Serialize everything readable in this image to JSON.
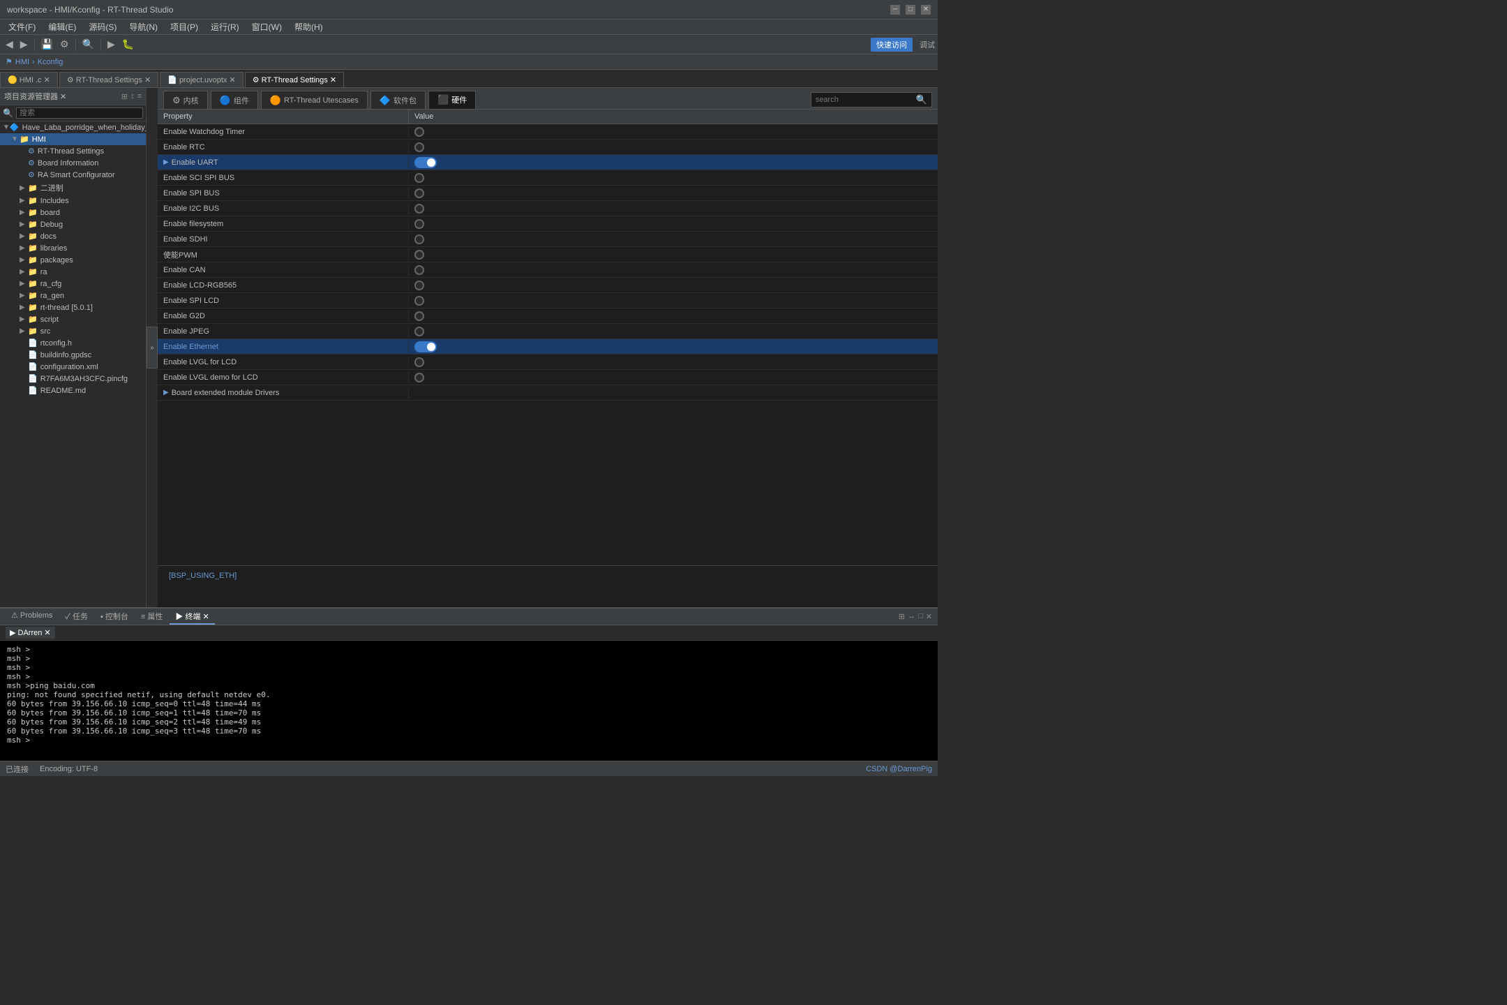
{
  "titleBar": {
    "text": "workspace - HMI/Kconfig - RT-Thread Studio",
    "controls": [
      "minimize",
      "maximize",
      "close"
    ]
  },
  "menuBar": {
    "items": [
      "文件(F)",
      "编辑(E)",
      "源码(S)",
      "导航(N)",
      "项目(P)",
      "运行(R)",
      "窗口(W)",
      "帮助(H)"
    ]
  },
  "breadcrumb": {
    "path": "HMI > Kconfig"
  },
  "mainTabs": [
    {
      "label": "HMI .c",
      "active": false
    },
    {
      "label": "RT-Thread Settings",
      "active": false
    },
    {
      "label": "project.uvoptx",
      "active": false
    },
    {
      "label": "RT-Thread Settings",
      "active": true
    }
  ],
  "sidebar": {
    "header": "项目资源管理器",
    "searchPlaceholder": "搜索",
    "tree": [
      {
        "id": "root",
        "label": "Have_Laba_porridge_when_holiday_come",
        "level": 0,
        "type": "project",
        "expanded": true
      },
      {
        "id": "hmi",
        "label": "HMI",
        "level": 1,
        "type": "folder",
        "expanded": true
      },
      {
        "id": "rt-thread-settings",
        "label": "RT-Thread Settings",
        "level": 2,
        "type": "settings"
      },
      {
        "id": "board-info",
        "label": "Board Information",
        "level": 2,
        "type": "settings"
      },
      {
        "id": "ra-smart",
        "label": "RA Smart Configurator",
        "level": 2,
        "type": "settings"
      },
      {
        "id": "binary",
        "label": "二进制",
        "level": 2,
        "type": "folder"
      },
      {
        "id": "includes",
        "label": "Includes",
        "level": 2,
        "type": "folder"
      },
      {
        "id": "board",
        "label": "board",
        "level": 2,
        "type": "folder"
      },
      {
        "id": "debug",
        "label": "Debug",
        "level": 2,
        "type": "folder"
      },
      {
        "id": "docs",
        "label": "docs",
        "level": 2,
        "type": "folder"
      },
      {
        "id": "libraries",
        "label": "libraries",
        "level": 2,
        "type": "folder"
      },
      {
        "id": "packages",
        "label": "packages",
        "level": 2,
        "type": "folder"
      },
      {
        "id": "ra",
        "label": "ra",
        "level": 2,
        "type": "folder"
      },
      {
        "id": "ra_cfg",
        "label": "ra_cfg",
        "level": 2,
        "type": "folder"
      },
      {
        "id": "ra_gen",
        "label": "ra_gen",
        "level": 2,
        "type": "folder"
      },
      {
        "id": "rt-thread",
        "label": "rt-thread [5.0.1]",
        "level": 2,
        "type": "folder"
      },
      {
        "id": "script",
        "label": "script",
        "level": 2,
        "type": "folder"
      },
      {
        "id": "src",
        "label": "src",
        "level": 2,
        "type": "folder"
      },
      {
        "id": "rtconfig-h",
        "label": "rtconfig.h",
        "level": 2,
        "type": "file"
      },
      {
        "id": "buildinfo",
        "label": "buildinfo.gpdsc",
        "level": 2,
        "type": "file"
      },
      {
        "id": "config-xml",
        "label": "configuration.xml",
        "level": 2,
        "type": "file"
      },
      {
        "id": "pincfg",
        "label": "R7FA6M3AH3CFC.pincfg",
        "level": 2,
        "type": "file"
      },
      {
        "id": "readme",
        "label": "README.md",
        "level": 2,
        "type": "file"
      }
    ]
  },
  "kconfig": {
    "tabs": [
      {
        "label": "内核",
        "icon": "⚙",
        "active": false
      },
      {
        "label": "组件",
        "icon": "🔵",
        "active": false
      },
      {
        "label": "RT-Thread Utescases",
        "icon": "🟠",
        "active": false
      },
      {
        "label": "软件包",
        "icon": "🔷",
        "active": false
      },
      {
        "label": "硬件",
        "icon": "⬛",
        "active": true
      }
    ],
    "search": {
      "placeholder": "search"
    },
    "tableHeaders": [
      "Property",
      "Value"
    ],
    "rows": [
      {
        "id": "watchdog",
        "label": "Enable Watchdog Timer",
        "type": "radio",
        "enabled": false,
        "highlighted": false,
        "expandable": false
      },
      {
        "id": "rtc",
        "label": "Enable RTC",
        "type": "radio",
        "enabled": false,
        "highlighted": false,
        "expandable": false
      },
      {
        "id": "uart",
        "label": "Enable UART",
        "type": "toggle",
        "enabled": true,
        "highlighted": true,
        "expandable": true
      },
      {
        "id": "sci-spi",
        "label": "Enable SCI SPI BUS",
        "type": "radio",
        "enabled": false,
        "highlighted": false,
        "expandable": false
      },
      {
        "id": "spi",
        "label": "Enable SPI BUS",
        "type": "radio",
        "enabled": false,
        "highlighted": false,
        "expandable": false
      },
      {
        "id": "i2c",
        "label": "Enable I2C BUS",
        "type": "radio",
        "enabled": false,
        "highlighted": false,
        "expandable": false
      },
      {
        "id": "fs",
        "label": "Enable filesystem",
        "type": "radio",
        "enabled": false,
        "highlighted": false,
        "expandable": false
      },
      {
        "id": "sdhi",
        "label": "Enable SDHI",
        "type": "radio",
        "enabled": false,
        "highlighted": false,
        "expandable": false
      },
      {
        "id": "pwm",
        "label": "使能PWM",
        "type": "radio",
        "enabled": false,
        "highlighted": false,
        "expandable": false
      },
      {
        "id": "can",
        "label": "Enable CAN",
        "type": "radio",
        "enabled": false,
        "highlighted": false,
        "expandable": false
      },
      {
        "id": "lcd-rgb",
        "label": "Enable LCD-RGB565",
        "type": "radio",
        "enabled": false,
        "highlighted": false,
        "expandable": false
      },
      {
        "id": "spi-lcd",
        "label": "Enable SPI LCD",
        "type": "radio",
        "enabled": false,
        "highlighted": false,
        "expandable": false
      },
      {
        "id": "g2d",
        "label": "Enable G2D",
        "type": "radio",
        "enabled": false,
        "highlighted": false,
        "expandable": false
      },
      {
        "id": "jpeg",
        "label": "Enable JPEG",
        "type": "radio",
        "enabled": false,
        "highlighted": false,
        "expandable": false
      },
      {
        "id": "eth",
        "label": "Enable Ethernet",
        "type": "toggle",
        "enabled": true,
        "highlighted": true,
        "expandable": false,
        "isLink": true
      },
      {
        "id": "lvgl",
        "label": "Enable LVGL for LCD",
        "type": "radio",
        "enabled": false,
        "highlighted": false,
        "expandable": false
      },
      {
        "id": "lvgl-demo",
        "label": "Enable LVGL demo for LCD",
        "type": "radio",
        "enabled": false,
        "highlighted": false,
        "expandable": false
      },
      {
        "id": "board-ext",
        "label": "Board extended module Drivers",
        "type": "none",
        "enabled": false,
        "highlighted": false,
        "expandable": true
      }
    ],
    "description": "[BSP_USING_ETH]"
  },
  "bottomPanel": {
    "tabs": [
      {
        "label": "Problems",
        "active": false
      },
      {
        "label": "任务",
        "active": false
      },
      {
        "label": "控制台",
        "active": false
      },
      {
        "label": "属性",
        "active": false
      },
      {
        "label": "终端",
        "active": true
      }
    ],
    "terminalTab": "DArren",
    "terminalLines": [
      "msh >",
      "msh >",
      "msh >",
      "msh >",
      "msh >ping baidu.com",
      "ping: not found specified netif, using default netdev e0.",
      "60 bytes from 39.156.66.10 icmp_seq=0 ttl=48 time=44 ms",
      "60 bytes from 39.156.66.10 icmp_seq=1 ttl=48 time=70 ms",
      "60 bytes from 39.156.66.10 icmp_seq=2 ttl=48 time=49 ms",
      "60 bytes from 39.156.66.10 icmp_seq=3 ttl=48 time=70 ms",
      "msh >"
    ]
  },
  "statusBar": {
    "left": "已连接",
    "encoding": "Encoding: UTF-8",
    "right": "CSDN @DarrenPig"
  }
}
